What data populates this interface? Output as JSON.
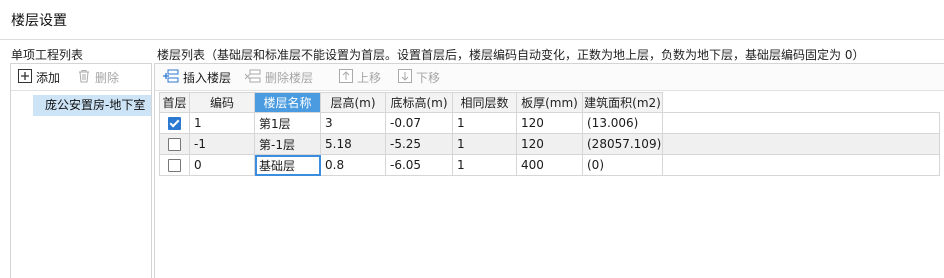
{
  "dialog": {
    "title": "楼层设置"
  },
  "left": {
    "label": "单项工程列表",
    "add_label": "添加",
    "delete_label": "删除",
    "items": [
      "庞公安置房-地下室"
    ]
  },
  "right": {
    "label": "楼层列表（基础层和标准层不能设置为首层。设置首层后，楼层编码自动变化，正数为地上层，负数为地下层，基础层编码固定为 0）",
    "toolbar": {
      "insert_label": "插入楼层",
      "delete_label": "删除楼层",
      "up_label": "上移",
      "down_label": "下移"
    },
    "columns": [
      "首层",
      "编码",
      "楼层名称",
      "层高(m)",
      "底标高(m)",
      "相同层数",
      "板厚(mm)",
      "建筑面积(m2)"
    ],
    "rows": [
      {
        "first": true,
        "code": "1",
        "name": "第1层",
        "height": "3",
        "bottom": "-0.07",
        "same": "1",
        "thickness": "120",
        "area": "(13.006)"
      },
      {
        "first": false,
        "code": "-1",
        "name": "第-1层",
        "height": "5.18",
        "bottom": "-5.25",
        "same": "1",
        "thickness": "120",
        "area": "(28057.109)"
      },
      {
        "first": false,
        "code": "0",
        "name": "基础层",
        "height": "0.8",
        "bottom": "-6.05",
        "same": "1",
        "thickness": "400",
        "area": "(0)"
      }
    ]
  },
  "colors": {
    "accent": "#4a9be0",
    "selection": "#cde4f7",
    "check": "#2b79d1"
  }
}
